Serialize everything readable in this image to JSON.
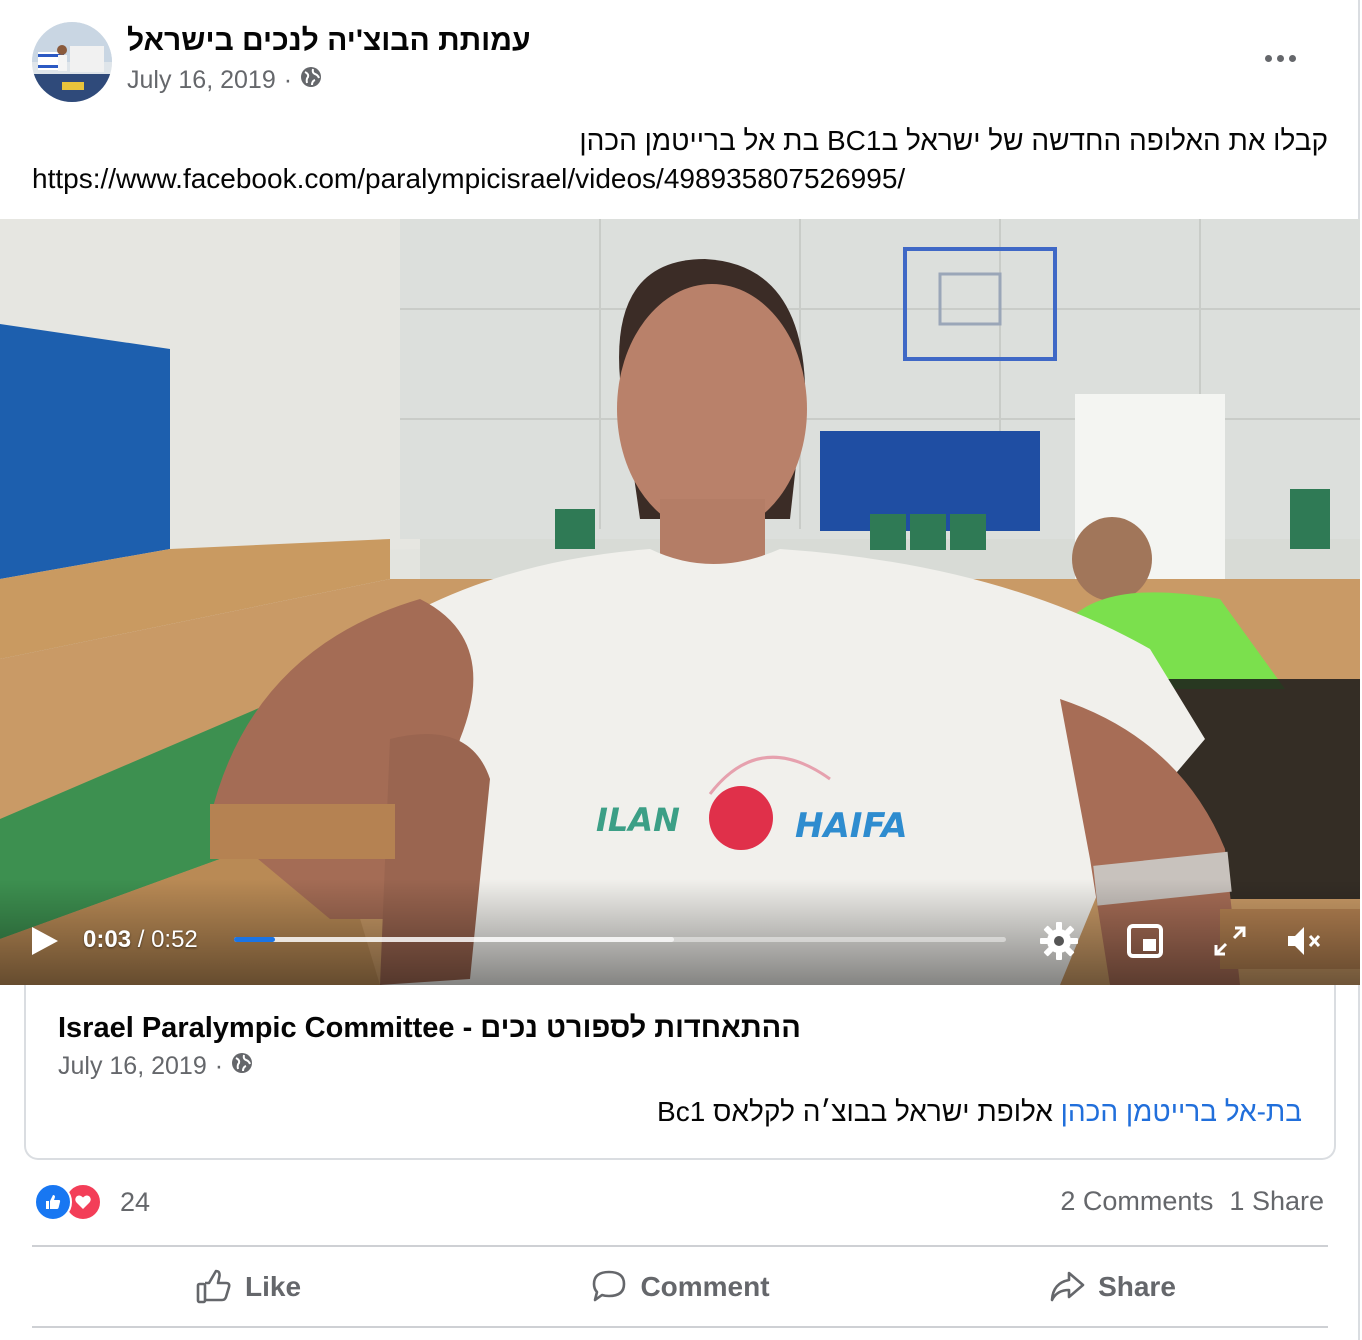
{
  "post": {
    "page_name": "עמותת הבוצ'יה לנכים בישראל",
    "date": "July 16, 2019",
    "separator": "·",
    "text": "קבלו את האלופה החדשה של ישראל בBC1 בת אל ברייטמן הכהן",
    "link": "https://www.facebook.com/paralympicisrael/videos/498935807526995/"
  },
  "video": {
    "current_time": "0:03",
    "time_separator": " / ",
    "duration": "0:52",
    "progress_played": 0.053,
    "progress_buffered": 0.57,
    "shirt_text_left": "ILAN",
    "shirt_text_right": "HAIFA"
  },
  "shared": {
    "page_name": "Israel Paralympic Committee - ההתאחדות לספורט נכים",
    "date": "July 16, 2019",
    "separator": "·",
    "tag": "בת-אל ברייטמן הכהן",
    "text": " אלופת ישראל בבוצ׳ה לקלאס Bc1"
  },
  "stats": {
    "reaction_count": "24",
    "comments": "2 Comments",
    "shares": "1 Share"
  },
  "actions": {
    "like": "Like",
    "comment": "Comment",
    "share": "Share"
  },
  "colors": {
    "accent": "#1877f2",
    "love": "#f33e58",
    "muted": "#65676b"
  }
}
